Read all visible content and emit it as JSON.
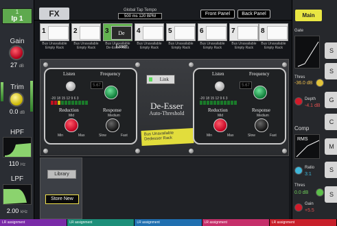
{
  "channel": {
    "number": "1",
    "name": "Ip 1"
  },
  "left_params": [
    {
      "label": "Gain",
      "value": "27",
      "unit": "dB"
    },
    {
      "label": "Trim",
      "value": "0.0",
      "unit": "dB"
    },
    {
      "label": "HPF",
      "value": "110",
      "unit": "Hz"
    },
    {
      "label": "LPF",
      "value": "2.00",
      "unit": "kHz"
    }
  ],
  "topbar": {
    "fx_label": "FX",
    "tempo_label": "Global Tap Tempo",
    "tempo_value": "500 ms    120 BPM",
    "front_panel": "Front Panel",
    "back_panel": "Back Panel"
  },
  "slots": [
    {
      "num": "1",
      "face": "",
      "line1": "Bus Unavailable",
      "line2": "Empty Rack"
    },
    {
      "num": "2",
      "face": "",
      "line1": "Bus Unavailable",
      "line2": "Empty Rack"
    },
    {
      "num": "3",
      "face": "De Esser",
      "line1": "Bus Unavailable",
      "line2": "De-Esser Rack"
    },
    {
      "num": "4",
      "face": "",
      "line1": "Bus Unavailable",
      "line2": "Empty Rack"
    },
    {
      "num": "5",
      "face": "",
      "line1": "Bus Unavailable",
      "line2": "Empty Rack"
    },
    {
      "num": "6",
      "face": "",
      "line1": "Bus Unavailable",
      "line2": "Empty Rack"
    },
    {
      "num": "7",
      "face": "",
      "line1": "Bus Unavailable",
      "line2": "Empty Rack"
    },
    {
      "num": "8",
      "face": "",
      "line1": "Bus Unavailable",
      "line2": "Empty Rack"
    }
  ],
  "deesser": {
    "listen": "Listen",
    "frequency": "Frequency",
    "freq_value": "5.67",
    "reduction": "Reduction",
    "response": "Response",
    "mid": "Mid",
    "min": "Min",
    "max": "Max",
    "medium": "Medium",
    "slow": "Slow",
    "fast": "Fast",
    "led_labels": "-20 18 15 12 9 6 3",
    "link": "Link",
    "brand": "De-Esser",
    "subtitle": "Auto-Threshold",
    "sticky": "Bus Unavailable Dedesser Rack"
  },
  "lower": {
    "library": "Library",
    "store_new": "Store New"
  },
  "right": {
    "main": "Main",
    "gate": "Gate",
    "gate_thresh_label": "Thres",
    "gate_thresh_value": "-36.0 dB",
    "depth_label": "Depth",
    "depth_value": "-4.1 dB",
    "comp": "Comp",
    "ratio_label": "Ratio",
    "ratio_value": "3:1",
    "comp_thresh_label": "Thres",
    "comp_thresh_value": "0.0 dB",
    "gain_label": "Gain",
    "gain_value": "+5.5",
    "tabs": [
      "S",
      "G",
      "C",
      "M",
      "S"
    ],
    "rms": "RMS"
  },
  "bottom": [
    "LR assignment",
    "LR assignment",
    "LR assignment",
    "LR assignment",
    "LR assignment"
  ],
  "colors": {
    "channel": "#5ea94e",
    "main": "#e9e643",
    "green_slot": "#63b450"
  }
}
